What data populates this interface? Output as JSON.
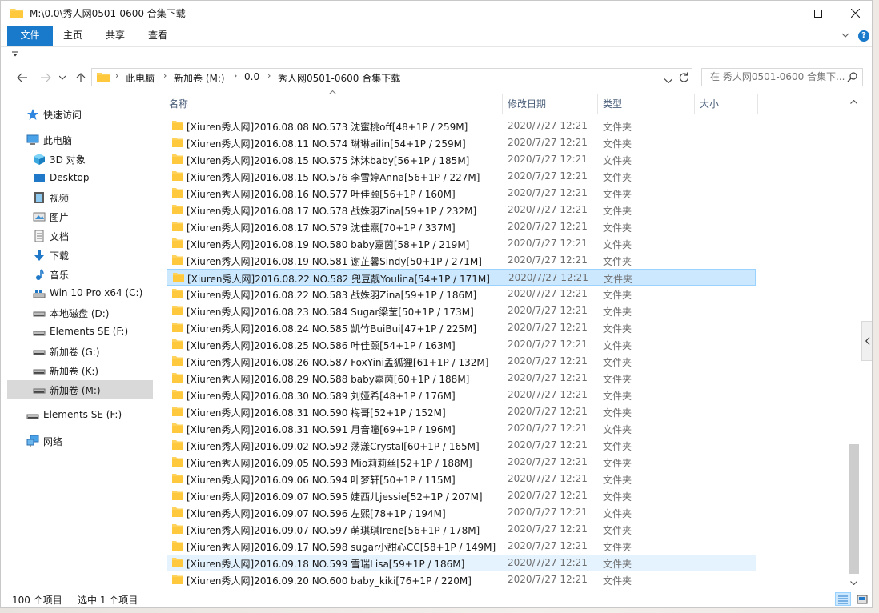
{
  "window": {
    "title": "M:\\0.0\\秀人网0501-0600 合集下载"
  },
  "ribbon": {
    "tabs": [
      "文件",
      "主页",
      "共享",
      "查看"
    ]
  },
  "address": {
    "crumbs": [
      "此电脑",
      "新加卷 (M:)",
      "0.0",
      "秀人网0501-0600 合集下载"
    ]
  },
  "search": {
    "placeholder": "在 秀人网0501-0600 合集下..."
  },
  "nav": [
    {
      "label": "快速访问",
      "icon": "star-icon"
    },
    {
      "label": "此电脑",
      "icon": "computer-icon"
    },
    {
      "label": "3D 对象",
      "icon": "cube-icon"
    },
    {
      "label": "Desktop",
      "icon": "desktop-icon"
    },
    {
      "label": "视频",
      "icon": "video-icon"
    },
    {
      "label": "图片",
      "icon": "pictures-icon"
    },
    {
      "label": "文档",
      "icon": "document-icon"
    },
    {
      "label": "下载",
      "icon": "download-icon"
    },
    {
      "label": "音乐",
      "icon": "music-icon"
    },
    {
      "label": "Win 10 Pro x64 (C:)",
      "icon": "windows-drive-icon"
    },
    {
      "label": "本地磁盘 (D:)",
      "icon": "drive-icon"
    },
    {
      "label": "Elements SE (F:)",
      "icon": "drive-icon"
    },
    {
      "label": "新加卷 (G:)",
      "icon": "drive-icon"
    },
    {
      "label": "新加卷 (K:)",
      "icon": "drive-icon"
    },
    {
      "label": "新加卷 (M:)",
      "icon": "drive-icon"
    },
    {
      "label": "Elements SE (F:)",
      "icon": "drive-icon"
    },
    {
      "label": "网络",
      "icon": "network-icon"
    }
  ],
  "columns": {
    "name": "名称",
    "date": "修改日期",
    "type": "类型",
    "size": "大小"
  },
  "files": [
    {
      "name": "[Xiuren秀人网]2016.08.08 NO.573 沈蜜桃off[48+1P / 259M]",
      "date": "2020/7/27 12:21",
      "type": "文件夹"
    },
    {
      "name": "[Xiuren秀人网]2016.08.11 NO.574 琳琳ailin[54+1P / 259M]",
      "date": "2020/7/27 12:21",
      "type": "文件夹"
    },
    {
      "name": "[Xiuren秀人网]2016.08.15 NO.575 沐沐baby[56+1P / 185M]",
      "date": "2020/7/27 12:21",
      "type": "文件夹"
    },
    {
      "name": "[Xiuren秀人网]2016.08.15 NO.576 李雪婷Anna[56+1P / 227M]",
      "date": "2020/7/27 12:21",
      "type": "文件夹"
    },
    {
      "name": "[Xiuren秀人网]2016.08.16 NO.577 叶佳颐[56+1P / 160M]",
      "date": "2020/7/27 12:21",
      "type": "文件夹"
    },
    {
      "name": "[Xiuren秀人网]2016.08.17 NO.578 战姝羽Zina[59+1P / 232M]",
      "date": "2020/7/27 12:21",
      "type": "文件夹"
    },
    {
      "name": "[Xiuren秀人网]2016.08.17 NO.579 沈佳熹[70+1P / 337M]",
      "date": "2020/7/27 12:21",
      "type": "文件夹"
    },
    {
      "name": "[Xiuren秀人网]2016.08.19 NO.580 baby嘉茵[58+1P / 219M]",
      "date": "2020/7/27 12:21",
      "type": "文件夹"
    },
    {
      "name": "[Xiuren秀人网]2016.08.19 NO.581 谢芷馨Sindy[50+1P / 271M]",
      "date": "2020/7/27 12:21",
      "type": "文件夹"
    },
    {
      "name": "[Xiuren秀人网]2016.08.22 NO.582 兜豆靓Youlina[54+1P / 171M]",
      "date": "2020/7/27 12:21",
      "type": "文件夹"
    },
    {
      "name": "[Xiuren秀人网]2016.08.22 NO.583 战姝羽Zina[59+1P / 186M]",
      "date": "2020/7/27 12:21",
      "type": "文件夹"
    },
    {
      "name": "[Xiuren秀人网]2016.08.23 NO.584 Sugar梁莹[50+1P / 173M]",
      "date": "2020/7/27 12:21",
      "type": "文件夹"
    },
    {
      "name": "[Xiuren秀人网]2016.08.24 NO.585 凯竹BuiBui[47+1P / 225M]",
      "date": "2020/7/27 12:21",
      "type": "文件夹"
    },
    {
      "name": "[Xiuren秀人网]2016.08.25 NO.586 叶佳颐[54+1P / 163M]",
      "date": "2020/7/27 12:21",
      "type": "文件夹"
    },
    {
      "name": "[Xiuren秀人网]2016.08.26 NO.587 FoxYini孟狐狸[61+1P / 132M]",
      "date": "2020/7/27 12:21",
      "type": "文件夹"
    },
    {
      "name": "[Xiuren秀人网]2016.08.29 NO.588 baby嘉茵[60+1P / 188M]",
      "date": "2020/7/27 12:21",
      "type": "文件夹"
    },
    {
      "name": "[Xiuren秀人网]2016.08.30 NO.589 刘娅希[48+1P / 176M]",
      "date": "2020/7/27 12:21",
      "type": "文件夹"
    },
    {
      "name": "[Xiuren秀人网]2016.08.31 NO.590 梅哥[52+1P / 152M]",
      "date": "2020/7/27 12:21",
      "type": "文件夹"
    },
    {
      "name": "[Xiuren秀人网]2016.08.31 NO.591 月音瞳[69+1P / 196M]",
      "date": "2020/7/27 12:21",
      "type": "文件夹"
    },
    {
      "name": "[Xiuren秀人网]2016.09.02 NO.592 荡漾Crystal[60+1P / 165M]",
      "date": "2020/7/27 12:21",
      "type": "文件夹"
    },
    {
      "name": "[Xiuren秀人网]2016.09.05 NO.593 Mio莉莉丝[52+1P / 188M]",
      "date": "2020/7/27 12:21",
      "type": "文件夹"
    },
    {
      "name": "[Xiuren秀人网]2016.09.06 NO.594 叶梦轩[50+1P / 115M]",
      "date": "2020/7/27 12:21",
      "type": "文件夹"
    },
    {
      "name": "[Xiuren秀人网]2016.09.07 NO.595 婕西儿jessie[52+1P / 207M]",
      "date": "2020/7/27 12:21",
      "type": "文件夹"
    },
    {
      "name": "[Xiuren秀人网]2016.09.07 NO.596 左熙[78+1P / 194M]",
      "date": "2020/7/27 12:21",
      "type": "文件夹"
    },
    {
      "name": "[Xiuren秀人网]2016.09.07 NO.597 萌琪琪Irene[56+1P / 178M]",
      "date": "2020/7/27 12:21",
      "type": "文件夹"
    },
    {
      "name": "[Xiuren秀人网]2016.09.17 NO.598 sugar小甜心CC[58+1P / 149M]",
      "date": "2020/7/27 12:21",
      "type": "文件夹"
    },
    {
      "name": "[Xiuren秀人网]2016.09.18 NO.599 雪瑞Lisa[59+1P / 186M]",
      "date": "2020/7/27 12:21",
      "type": "文件夹"
    },
    {
      "name": "[Xiuren秀人网]2016.09.20 NO.600 baby_kiki[76+1P / 220M]",
      "date": "2020/7/27 12:21",
      "type": "文件夹"
    }
  ],
  "selected_index": 9,
  "hover_index": 26,
  "status": {
    "count": "100 个项目",
    "selected": "选中 1 个项目"
  },
  "colors": {
    "accent": "#1979ca",
    "selection": "#cce8ff",
    "folder": "#ffd35b"
  }
}
